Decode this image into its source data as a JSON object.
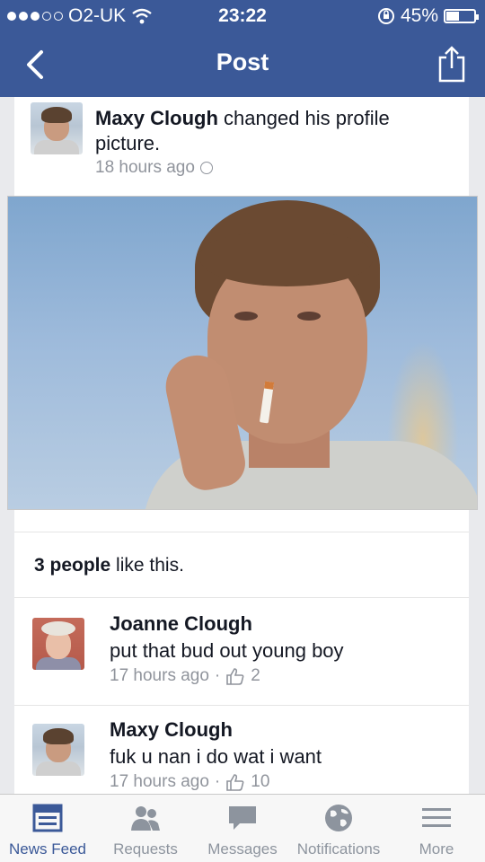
{
  "status_bar": {
    "carrier": "O2-UK",
    "time": "23:22",
    "battery": "45%",
    "battery_level": 0.45,
    "signal_bars": 3
  },
  "nav": {
    "title": "Post"
  },
  "post": {
    "author": "Maxy Clough",
    "action": "changed his profile picture.",
    "time": "18 hours ago"
  },
  "likes": {
    "count": "3 people",
    "suffix": "like this."
  },
  "comments": [
    {
      "name": "Joanne Clough",
      "text": "put that bud out young boy",
      "time": "17 hours ago",
      "likes": "2"
    },
    {
      "name": "Maxy Clough",
      "text": "fuk u nan i do wat i want",
      "time": "17 hours ago",
      "likes": "10"
    }
  ],
  "tab_bar": {
    "items": [
      {
        "label": "News Feed",
        "icon": "news-feed-icon",
        "active": true
      },
      {
        "label": "Requests",
        "icon": "friend-requests-icon",
        "active": false
      },
      {
        "label": "Messages",
        "icon": "messages-icon",
        "active": false
      },
      {
        "label": "Notifications",
        "icon": "globe-icon",
        "active": false
      },
      {
        "label": "More",
        "icon": "menu-icon",
        "active": false
      }
    ]
  },
  "colors": {
    "brand": "#3b5998",
    "meta_text": "#90949c",
    "background": "#e9eaed"
  }
}
